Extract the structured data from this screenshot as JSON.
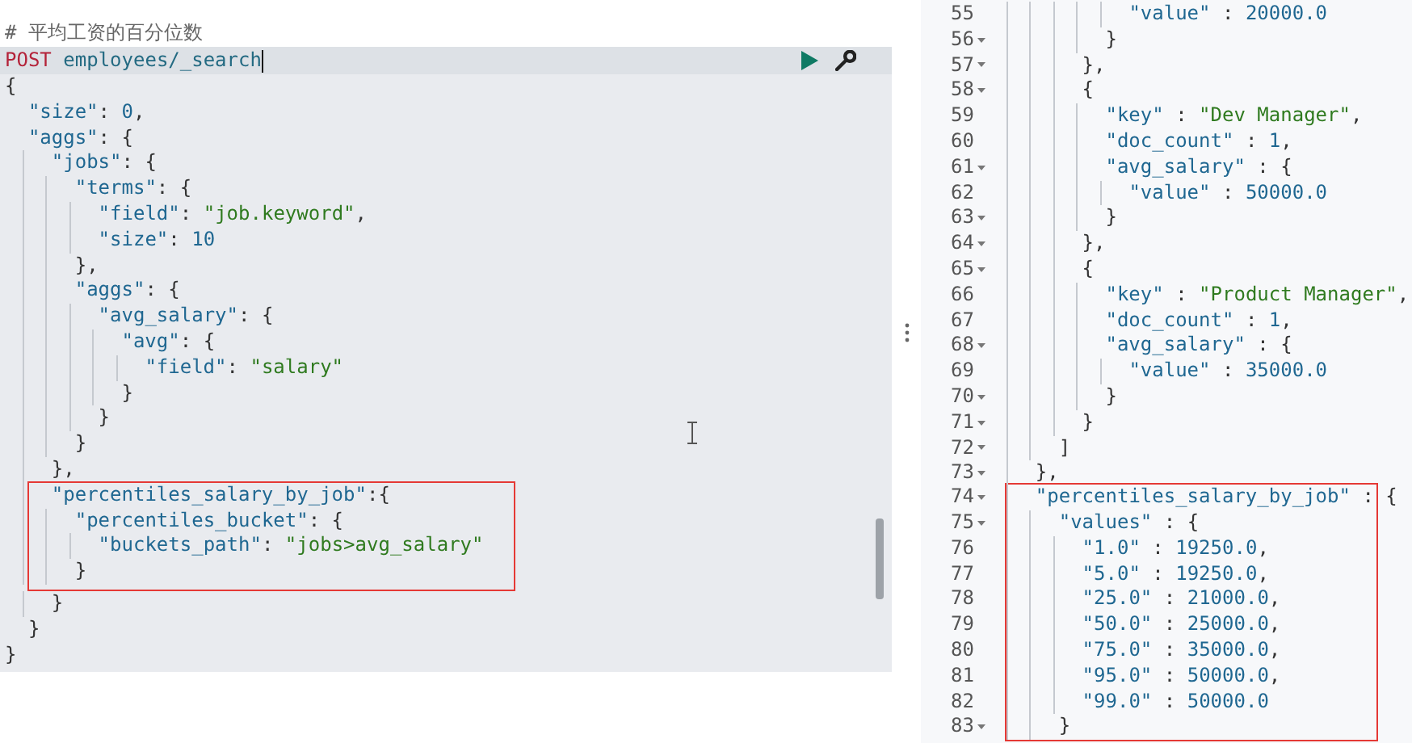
{
  "editor": {
    "comment": "# 平均工资的百分位数",
    "request": {
      "method": "POST",
      "path": "employees/_search"
    },
    "lines": [
      {
        "kind": "line",
        "text": "{"
      },
      {
        "kind": "line",
        "text": "  \"size\": 0,"
      },
      {
        "kind": "line",
        "text": "  \"aggs\": {"
      },
      {
        "kind": "line",
        "text": "    \"jobs\": {"
      },
      {
        "kind": "line",
        "text": "      \"terms\": {"
      },
      {
        "kind": "line",
        "text": "        \"field\": \"job.keyword\","
      },
      {
        "kind": "line",
        "text": "        \"size\": 10"
      },
      {
        "kind": "line",
        "text": "      },"
      },
      {
        "kind": "line",
        "text": "      \"aggs\": {"
      },
      {
        "kind": "line",
        "text": "        \"avg_salary\": {"
      },
      {
        "kind": "line",
        "text": "          \"avg\": {"
      },
      {
        "kind": "line",
        "text": "            \"field\": \"salary\""
      },
      {
        "kind": "line",
        "text": "          }"
      },
      {
        "kind": "line",
        "text": "        }"
      },
      {
        "kind": "line",
        "text": "      }"
      },
      {
        "kind": "line",
        "text": "    },"
      },
      {
        "kind": "highlight",
        "lines": [
          {
            "text": "    \"percentiles_salary_by_job\":{"
          },
          {
            "text": "      \"percentiles_bucket\": {"
          },
          {
            "text": "        \"buckets_path\": \"jobs>avg_salary\""
          },
          {
            "text": "      }"
          }
        ]
      },
      {
        "kind": "line",
        "text": "    }"
      },
      {
        "kind": "line",
        "text": "  }"
      },
      {
        "kind": "line",
        "text": "}"
      }
    ]
  },
  "response": {
    "lines": [
      {
        "kind": "line",
        "no": "55",
        "fold": false,
        "text": "            \"value\" : 20000.0"
      },
      {
        "kind": "line",
        "no": "56",
        "fold": true,
        "text": "          }"
      },
      {
        "kind": "line",
        "no": "57",
        "fold": true,
        "text": "        },"
      },
      {
        "kind": "line",
        "no": "58",
        "fold": true,
        "text": "        {"
      },
      {
        "kind": "line",
        "no": "59",
        "fold": false,
        "text": "          \"key\" : \"Dev Manager\","
      },
      {
        "kind": "line",
        "no": "60",
        "fold": false,
        "text": "          \"doc_count\" : 1,"
      },
      {
        "kind": "line",
        "no": "61",
        "fold": true,
        "text": "          \"avg_salary\" : {"
      },
      {
        "kind": "line",
        "no": "62",
        "fold": false,
        "text": "            \"value\" : 50000.0"
      },
      {
        "kind": "line",
        "no": "63",
        "fold": true,
        "text": "          }"
      },
      {
        "kind": "line",
        "no": "64",
        "fold": true,
        "text": "        },"
      },
      {
        "kind": "line",
        "no": "65",
        "fold": true,
        "text": "        {"
      },
      {
        "kind": "line",
        "no": "66",
        "fold": false,
        "text": "          \"key\" : \"Product Manager\","
      },
      {
        "kind": "line",
        "no": "67",
        "fold": false,
        "text": "          \"doc_count\" : 1,"
      },
      {
        "kind": "line",
        "no": "68",
        "fold": true,
        "text": "          \"avg_salary\" : {"
      },
      {
        "kind": "line",
        "no": "69",
        "fold": false,
        "text": "            \"value\" : 35000.0"
      },
      {
        "kind": "line",
        "no": "70",
        "fold": true,
        "text": "          }"
      },
      {
        "kind": "line",
        "no": "71",
        "fold": true,
        "text": "        }"
      },
      {
        "kind": "line",
        "no": "72",
        "fold": true,
        "text": "      ]"
      },
      {
        "kind": "line",
        "no": "73",
        "fold": true,
        "text": "    },"
      },
      {
        "kind": "highlight",
        "lines": [
          {
            "no": "74",
            "fold": true,
            "text": "    \"percentiles_salary_by_job\" : {"
          },
          {
            "no": "75",
            "fold": true,
            "text": "      \"values\" : {"
          },
          {
            "no": "76",
            "fold": false,
            "text": "        \"1.0\" : 19250.0,"
          },
          {
            "no": "77",
            "fold": false,
            "text": "        \"5.0\" : 19250.0,"
          },
          {
            "no": "78",
            "fold": false,
            "text": "        \"25.0\" : 21000.0,"
          },
          {
            "no": "79",
            "fold": false,
            "text": "        \"50.0\" : 25000.0,"
          },
          {
            "no": "80",
            "fold": false,
            "text": "        \"75.0\" : 35000.0,"
          },
          {
            "no": "81",
            "fold": false,
            "text": "        \"95.0\" : 50000.0,"
          },
          {
            "no": "82",
            "fold": false,
            "text": "        \"99.0\" : 50000.0"
          },
          {
            "no": "83",
            "fold": true,
            "text": "      }"
          }
        ]
      }
    ]
  }
}
